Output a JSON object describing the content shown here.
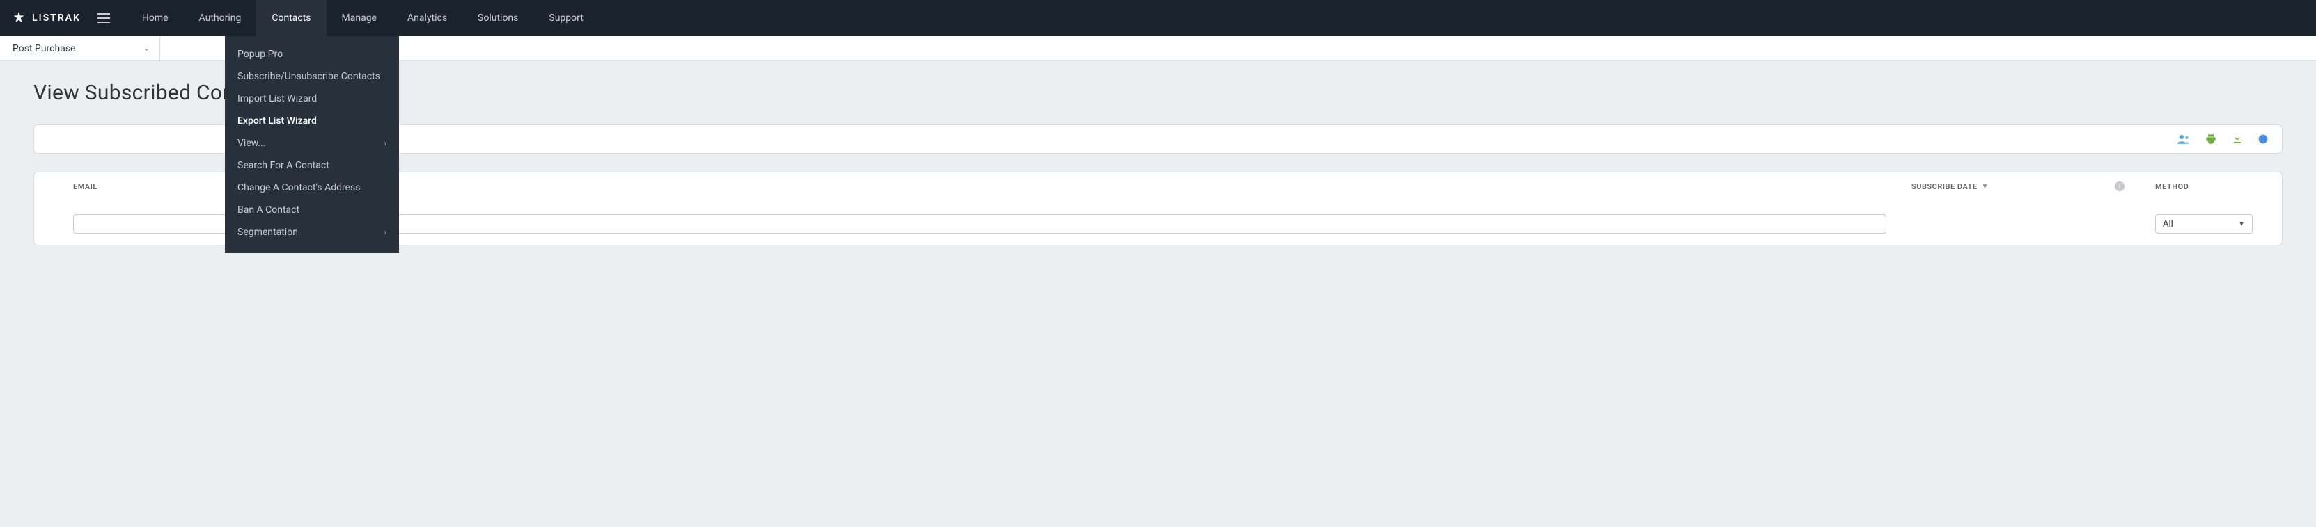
{
  "brand": {
    "name": "LISTRAK"
  },
  "nav": {
    "items": [
      {
        "label": "Home"
      },
      {
        "label": "Authoring"
      },
      {
        "label": "Contacts",
        "active": true
      },
      {
        "label": "Manage"
      },
      {
        "label": "Analytics"
      },
      {
        "label": "Solutions"
      },
      {
        "label": "Support"
      }
    ]
  },
  "list_selector": {
    "value": "Post Purchase"
  },
  "page": {
    "title": "View Subscribed Contacts"
  },
  "dropdown": {
    "items": [
      {
        "label": "Popup Pro"
      },
      {
        "label": "Subscribe/Unsubscribe Contacts"
      },
      {
        "label": "Import List Wizard"
      },
      {
        "label": "Export List Wizard",
        "highlight": true
      },
      {
        "label": "View...",
        "submenu": true
      },
      {
        "label": "Search For A Contact"
      },
      {
        "label": "Change A Contact's Address"
      },
      {
        "label": "Ban A Contact"
      },
      {
        "label": "Segmentation",
        "submenu": true
      }
    ]
  },
  "grid": {
    "columns": {
      "email": "EMAIL",
      "subscribe_date": "SUBSCRIBE DATE",
      "method": "METHOD"
    },
    "filters": {
      "email_value": "",
      "method_selected": "All"
    }
  },
  "toolbar": {
    "icons": [
      "add-contact-icon",
      "print-icon",
      "download-icon",
      "info-icon"
    ]
  }
}
